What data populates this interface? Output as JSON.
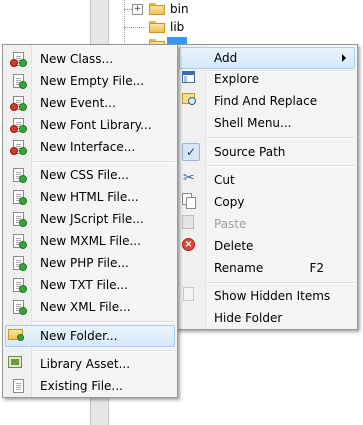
{
  "tree": {
    "nodes": [
      {
        "label": "bin",
        "expander": "+"
      },
      {
        "label": "lib"
      }
    ]
  },
  "context_menu": {
    "items": [
      {
        "label": "Add",
        "icon": "none",
        "submenu": true
      },
      {
        "label": "Explore",
        "icon": "window-icon"
      },
      {
        "label": "Find And Replace",
        "icon": "find-replace-icon"
      },
      {
        "label": "Shell Menu...",
        "icon": "none"
      },
      {
        "label": "Source Path",
        "icon": "checkmark-icon",
        "checked": true
      },
      {
        "label": "Cut",
        "icon": "scissors-icon"
      },
      {
        "label": "Copy",
        "icon": "copy-icon"
      },
      {
        "label": "Paste",
        "icon": "paste-icon",
        "disabled": true
      },
      {
        "label": "Delete",
        "icon": "delete-icon"
      },
      {
        "label": "Rename",
        "icon": "none",
        "shortcut": "F2"
      },
      {
        "label": "Show Hidden Items",
        "icon": "hidden-items-icon"
      },
      {
        "label": "Hide Folder",
        "icon": "none"
      }
    ]
  },
  "add_submenu": {
    "items": [
      {
        "label": "New Class..."
      },
      {
        "label": "New Empty File..."
      },
      {
        "label": "New Event..."
      },
      {
        "label": "New Font Library..."
      },
      {
        "label": "New Interface..."
      },
      {
        "label": "New CSS File..."
      },
      {
        "label": "New HTML File..."
      },
      {
        "label": "New JScript File..."
      },
      {
        "label": "New MXML File..."
      },
      {
        "label": "New PHP File..."
      },
      {
        "label": "New TXT File..."
      },
      {
        "label": "New XML File..."
      },
      {
        "label": "New Folder...",
        "highlighted": true
      },
      {
        "label": "Library Asset..."
      },
      {
        "label": "Existing File..."
      }
    ]
  },
  "colors": {
    "highlight": "#d5e9fb",
    "highlight_border": "#a7cdf0",
    "menu_bg": "#f5f5f5",
    "disabled_text": "#a0a0a0"
  }
}
